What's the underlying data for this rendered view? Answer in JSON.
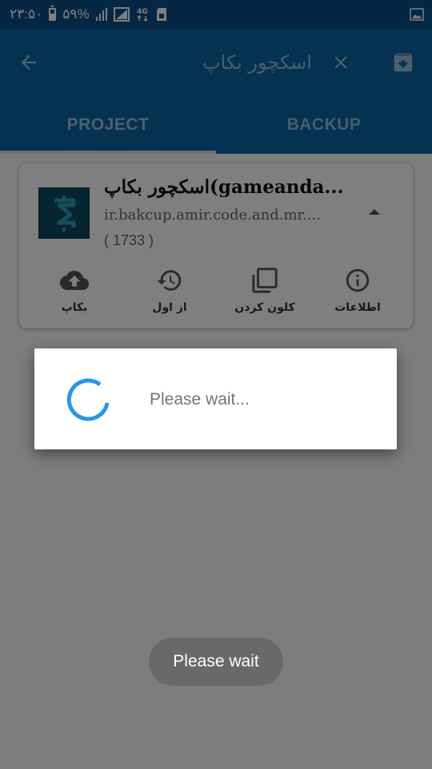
{
  "status_bar": {
    "time": "۲۳:۵۰",
    "battery_percent": "۵۹%",
    "battery_level": 0.59,
    "network_label": "4G",
    "icons": [
      "battery-icon",
      "signal-icon",
      "wifi-icon",
      "network-4g-icon",
      "sim-icon",
      "image-notification-icon"
    ]
  },
  "toolbar": {
    "search_query": "اسکچور بکاپ",
    "icons": [
      "back-arrow-icon",
      "close-icon",
      "archive-down-icon"
    ]
  },
  "tabs": [
    {
      "label": "PROJECT",
      "selected": true
    },
    {
      "label": "BACKUP",
      "selected": false
    }
  ],
  "card": {
    "title": "اسکچور بکاپ(gameanda...",
    "package": "ir.bakcup.amir.code.and.mr....",
    "count": "( 1733 )",
    "icon": "sketchware-app-icon",
    "collapse_icon": "arrow-up-icon",
    "actions": [
      {
        "label": "بکاپ",
        "icon": "cloud-upload-icon"
      },
      {
        "label": "از اول",
        "icon": "history-restore-icon"
      },
      {
        "label": "کلون کردن",
        "icon": "clone-copy-icon"
      },
      {
        "label": "اطلاعات",
        "icon": "info-icon"
      }
    ]
  },
  "dialog": {
    "message": "Please wait...",
    "spinner_icon": "loading-spinner-icon"
  },
  "toast": {
    "message": "Please wait"
  },
  "colors": {
    "status_bar": "#0b4f86",
    "app_bar": "#0d64a5",
    "spinner": "#2196f3",
    "scrim": "#7f7f7f"
  }
}
